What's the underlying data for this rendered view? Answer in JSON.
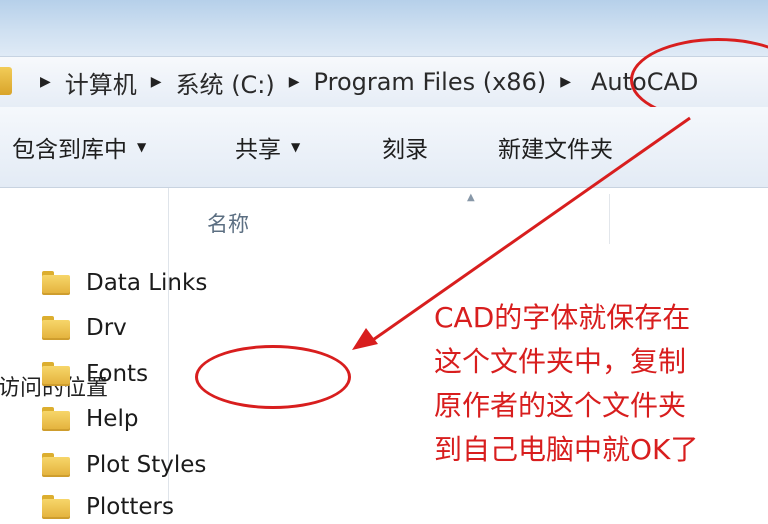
{
  "address_bar": {
    "crumbs": [
      "计算机",
      "系统 (C:)",
      "Program Files (x86)",
      "AutoCAD"
    ]
  },
  "toolbar": {
    "include_in_library": "包含到库中",
    "share": "共享",
    "burn": "刻录",
    "new_folder": "新建文件夹"
  },
  "nav_pane": {
    "recent_places": "访问的位置"
  },
  "file_list": {
    "column_name": "名称",
    "items": [
      "Data Links",
      "Drv",
      "Fonts",
      "Help",
      "Plot Styles",
      "Plotters"
    ]
  },
  "annotation": {
    "lines": [
      "CAD的字体就保存在",
      "这个文件夹中，复制",
      "原作者的这个文件夹",
      "到自己电脑中就OK了"
    ]
  },
  "colors": {
    "annotation_red": "#d81e1e",
    "folder_yellow": "#f2c94c"
  }
}
